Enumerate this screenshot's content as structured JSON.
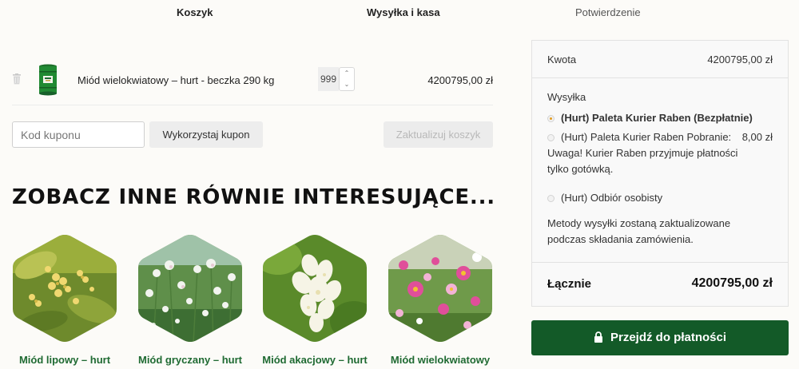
{
  "steps": {
    "cart": "Koszyk",
    "shipping": "Wysyłka i kasa",
    "confirmation": "Potwierdzenie"
  },
  "cart": {
    "product_name": "Miód wielokwiatowy – hurt - beczka 290 kg",
    "quantity": "999",
    "subtotal": "4200795,00 zł",
    "coupon_placeholder": "Kod kuponu",
    "apply_coupon": "Wykorzystaj kupon",
    "update_cart": "Zaktualizuj koszyk"
  },
  "related": {
    "title": "ZOBACZ INNE RÓWNIE INTERESUJĄCE...",
    "products": [
      {
        "name": "Miód lipowy – hurt",
        "image": "linden-flowers"
      },
      {
        "name": "Miód gryczany – hurt",
        "image": "buckwheat-flowers"
      },
      {
        "name": "Miód akacjowy – hurt",
        "image": "acacia-flowers"
      },
      {
        "name": "Miód wielokwiatowy",
        "image": "wildflowers"
      }
    ]
  },
  "summary": {
    "amount_label": "Kwota",
    "amount_value": "4200795,00 zł",
    "shipping_label": "Wysyłka",
    "options": [
      {
        "label": "(Hurt) Paleta Kurier Raben (Bezpłatnie)",
        "price": "",
        "selected": true
      },
      {
        "label": "(Hurt) Paleta Kurier Raben Pobranie:",
        "price": "8,00 zł",
        "selected": false
      },
      {
        "label": "(Hurt) Odbiór osobisty",
        "price": "",
        "selected": false
      }
    ],
    "warning_line1": "Uwaga! Kurier Raben przyjmuje płatności",
    "warning_line2": "tylko gotówką.",
    "shipping_note": "Metody wysyłki zostaną zaktualizowane podczas składania zamówienia.",
    "total_label": "Łącznie",
    "total_value": "4200795,00 zł"
  },
  "checkout_label": "Przejdź do płatności",
  "colors": {
    "brand_green": "#135a28",
    "product_link": "#1f6a32",
    "radio_selected": "#e39b1f",
    "background": "#fcfbf8"
  }
}
